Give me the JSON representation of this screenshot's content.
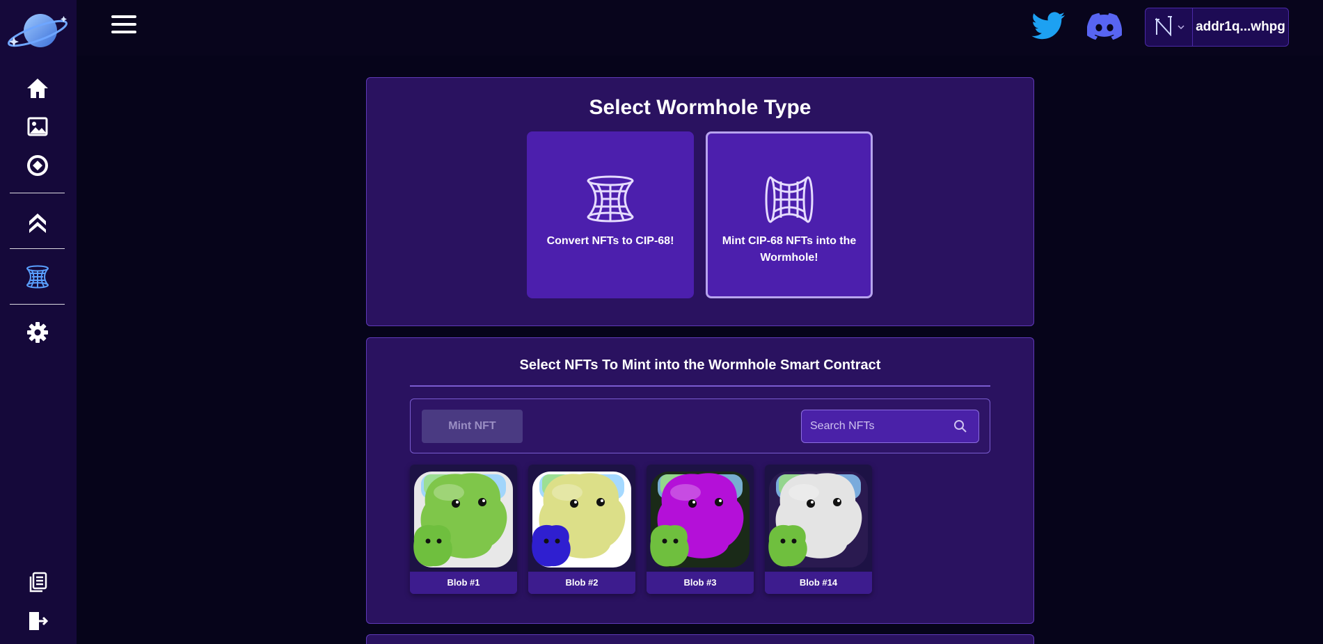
{
  "colors": {
    "bg": "#06041a",
    "sidebar": "#15093a",
    "panel": "#2a1260",
    "accent": "#4c1fad",
    "twitter": "#1da1f2",
    "discord": "#5865f2"
  },
  "sidebar": {
    "icons": [
      "planet-logo-icon",
      "home-icon",
      "image-icon",
      "compass-icon",
      "chevrons-up-icon",
      "wormhole-icon",
      "gear-icon",
      "documents-icon",
      "logout-icon"
    ]
  },
  "topbar": {
    "wallet_address": "addr1q...whpg"
  },
  "wormhole_section": {
    "title": "Select Wormhole Type",
    "options": [
      {
        "label": "Convert NFTs to CIP-68!",
        "selected": false
      },
      {
        "label": "Mint CIP-68 NFTs into the Wormhole!",
        "selected": true
      }
    ]
  },
  "nft_section": {
    "title": "Select NFTs To Mint into the Wormhole Smart Contract",
    "mint_button": "Mint NFT",
    "search_placeholder": "Search NFTs",
    "cards": [
      {
        "name": "Blob #1",
        "color": "#7fc64a",
        "baby_color": "#6fbf3e",
        "frame": "#e8e8e8"
      },
      {
        "name": "Blob #2",
        "color": "#dcdf88",
        "baby_color": "#2f1fd0",
        "frame": "#ffffff"
      },
      {
        "name": "Blob #3",
        "color": "#b410d8",
        "baby_color": "#6fbf3e",
        "frame": "#1a2a18"
      },
      {
        "name": "Blob #14",
        "color": "#e4e4e4",
        "baby_color": "#6fbf3e",
        "frame": "#2a1a50"
      }
    ]
  }
}
